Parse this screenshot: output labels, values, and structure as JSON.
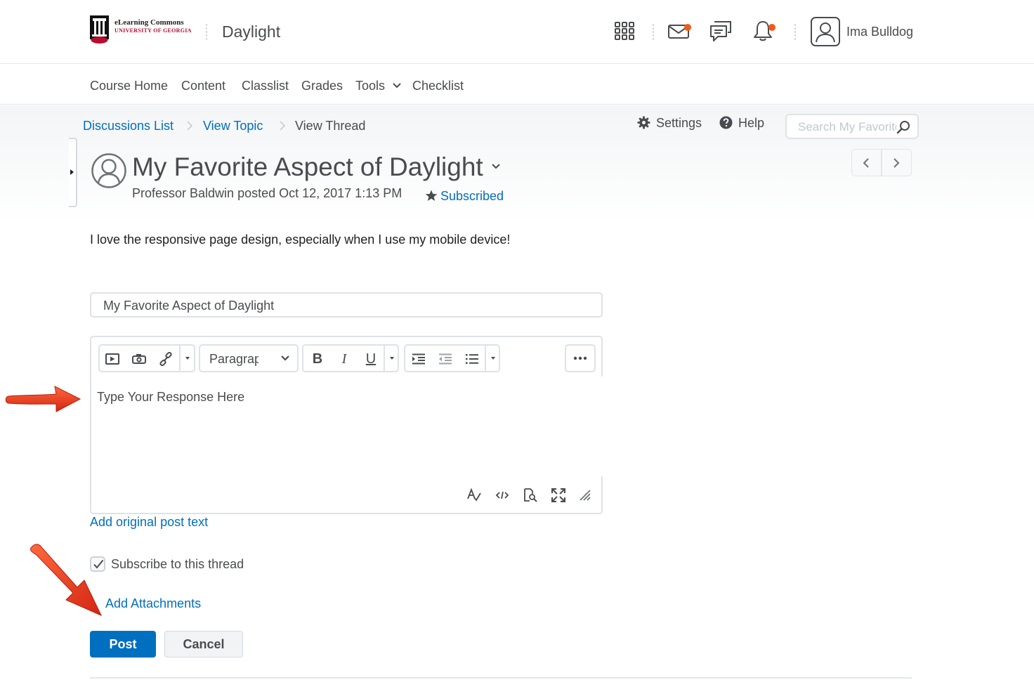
{
  "header": {
    "logo": {
      "line1": "eLearning Commons",
      "line2": "UNIVERSITY OF GEORGIA"
    },
    "org_name": "Daylight",
    "icons": [
      "grid-icon",
      "mail-icon",
      "chat-icon",
      "bell-icon"
    ],
    "user_name": "Ima Bulldog",
    "accent_color": "#f05a1a"
  },
  "nav": {
    "items": [
      {
        "label": "Course Home"
      },
      {
        "label": "Content"
      },
      {
        "label": "Classlist"
      },
      {
        "label": "Grades"
      },
      {
        "label": "Tools"
      },
      {
        "label": "Checklist"
      }
    ]
  },
  "breadcrumb": {
    "items": [
      {
        "label": "Discussions List"
      },
      {
        "label": "View Topic"
      },
      {
        "label": "View Thread"
      }
    ]
  },
  "toolbar": {
    "settings_label": "Settings",
    "help_label": "Help",
    "search_placeholder": "Search My Favorites"
  },
  "post": {
    "title": "My Favorite Aspect of Daylight",
    "meta": "Professor Baldwin posted Oct 12, 2017 1:13 PM",
    "subscribed_label": "Subscribed",
    "body": "I love the responsive page design, especially when I use my mobile device!"
  },
  "reply": {
    "subject_value": "My Favorite Aspect of Daylight",
    "format_label": "Paragraph",
    "bold_label": "B",
    "italic_label": "I",
    "underline_label": "U",
    "response_placeholder": "Type Your Response Here",
    "add_original_label": "Add original post text",
    "subscribe_label": "Subscribe to this thread",
    "subscribe_checked": true,
    "add_attachments_label": "Add Attachments",
    "post_label": "Post",
    "cancel_label": "Cancel"
  },
  "colors": {
    "link": "#006fbf",
    "primary_button": "#006fbf",
    "annotation_arrow": "#e8321a"
  }
}
